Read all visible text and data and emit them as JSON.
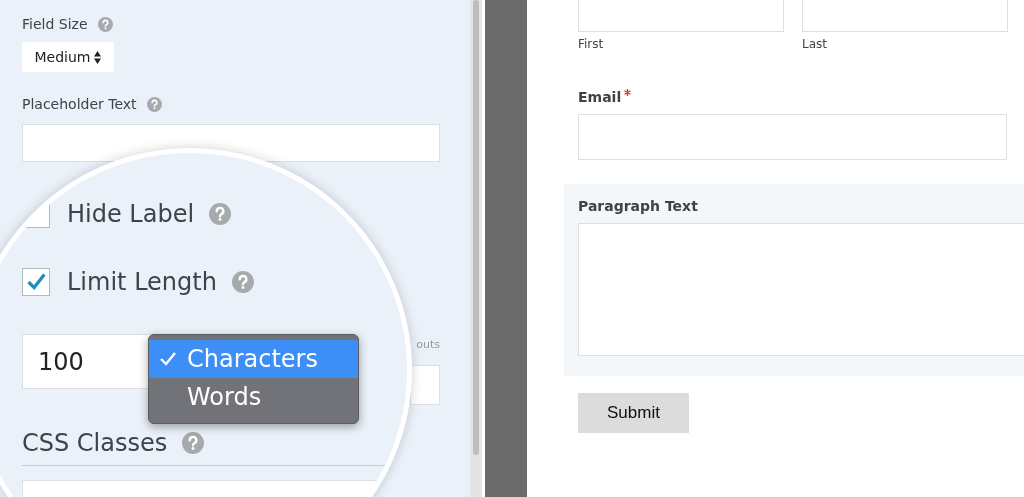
{
  "settings": {
    "field_size": {
      "label": "Field Size",
      "value": "Medium"
    },
    "placeholder_text": {
      "label": "Placeholder Text"
    },
    "partial_label": "outs"
  },
  "magnifier": {
    "hide_label": {
      "label": "Hide Label",
      "checked": false
    },
    "limit_length": {
      "label": "Limit Length",
      "checked": true
    },
    "length_value": "100",
    "unit_menu": [
      {
        "label": "Characters",
        "selected": true
      },
      {
        "label": "Words",
        "selected": false
      }
    ],
    "css_classes": {
      "label": "CSS Classes"
    }
  },
  "form": {
    "name_fields": [
      {
        "sublabel": "First"
      },
      {
        "sublabel": "Last"
      }
    ],
    "email": {
      "label": "Email",
      "required": true
    },
    "paragraph": {
      "label": "Paragraph Text",
      "highlighted": true
    },
    "submit": "Submit"
  }
}
